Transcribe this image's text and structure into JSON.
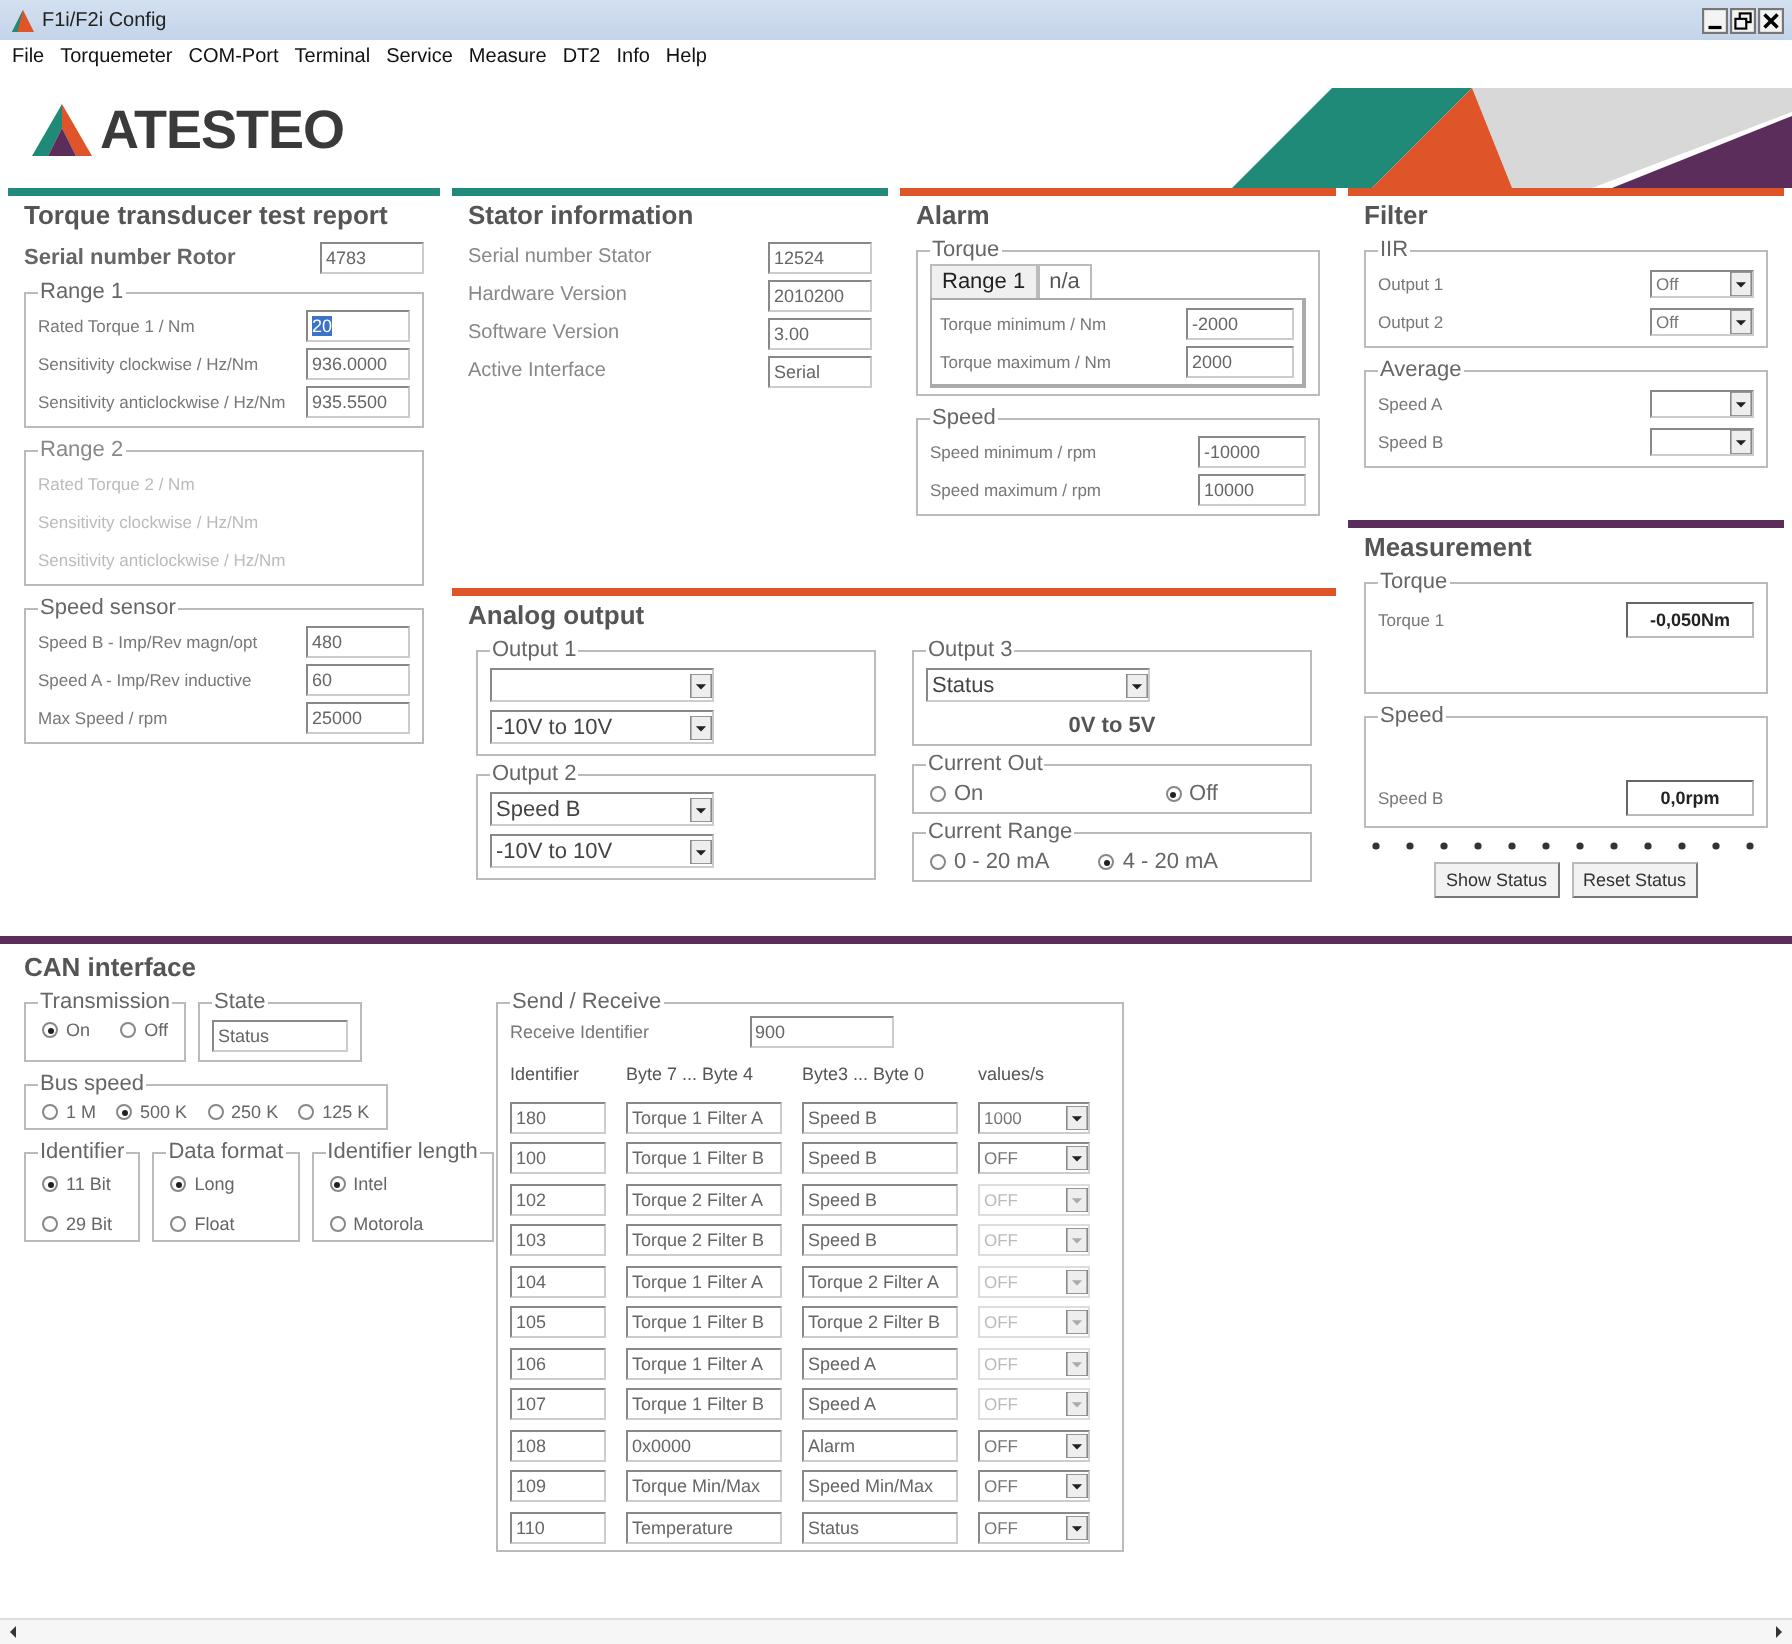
{
  "window": {
    "title": "F1i/F2i Config"
  },
  "menu": [
    "File",
    "Torquemeter",
    "COM-Port",
    "Terminal",
    "Service",
    "Measure",
    "DT2",
    "Info",
    "Help"
  ],
  "logo": {
    "text": "ATESTEO"
  },
  "test_report": {
    "title": "Torque transducer test report",
    "serial": {
      "kind": "input",
      "label": "Serial number Rotor",
      "value": "4783"
    },
    "groups": [
      {
        "title": "Range 1",
        "disabled": false,
        "items": [
          {
            "kind": "input",
            "label": "Rated Torque 1 / Nm",
            "value": "20",
            "highlighted": true
          },
          {
            "kind": "input",
            "label": "Sensitivity clockwise / Hz/Nm",
            "value": "936.0000",
            "highlighted": false
          },
          {
            "kind": "input",
            "label": "Sensitivity anticlockwise / Hz/Nm",
            "value": "935.5500",
            "highlighted": false
          }
        ]
      },
      {
        "title": "Range 2",
        "disabled": true,
        "items": [
          {
            "kind": "label",
            "label": "Rated Torque 2 / Nm"
          },
          {
            "kind": "label",
            "label": "Sensitivity clockwise / Hz/Nm"
          },
          {
            "kind": "label",
            "label": "Sensitivity anticlockwise / Hz/Nm"
          }
        ]
      },
      {
        "title": "Speed sensor",
        "disabled": false,
        "items": [
          {
            "kind": "input",
            "label": "Speed B - Imp/Rev magn/opt",
            "value": "480"
          },
          {
            "kind": "input",
            "label": "Speed A - Imp/Rev inductive",
            "value": "60"
          },
          {
            "kind": "input",
            "label": "Max Speed / rpm",
            "value": "25000"
          }
        ]
      }
    ]
  },
  "stator": {
    "title": "Stator information",
    "items": [
      {
        "kind": "input",
        "label": "Serial number Stator",
        "value": "12524"
      },
      {
        "kind": "input",
        "label": "Hardware Version",
        "value": "2010200"
      },
      {
        "kind": "input",
        "label": "Software Version",
        "value": "3.00"
      },
      {
        "kind": "input",
        "label": "Active Interface",
        "value": "Serial"
      }
    ]
  },
  "alarm": {
    "title": "Alarm",
    "torque": {
      "title": "Torque",
      "tabs": [
        {
          "label": "Range 1",
          "selected": true
        },
        {
          "label": "n/a",
          "selected": false
        }
      ],
      "items": [
        {
          "kind": "input",
          "label": "Torque minimum / Nm",
          "value": "-2000"
        },
        {
          "kind": "input",
          "label": "Torque maximum / Nm",
          "value": "2000"
        }
      ]
    },
    "speed": {
      "title": "Speed",
      "items": [
        {
          "kind": "input",
          "label": "Speed minimum / rpm",
          "value": "-10000"
        },
        {
          "kind": "input",
          "label": "Speed maximum / rpm",
          "value": "10000"
        }
      ]
    }
  },
  "filter": {
    "title": "Filter",
    "groups": [
      {
        "title": "IIR",
        "items": [
          {
            "kind": "select",
            "label": "Output 1",
            "value": "Off"
          },
          {
            "kind": "select",
            "label": "Output 2",
            "value": "Off"
          }
        ]
      },
      {
        "title": "Average",
        "items": [
          {
            "kind": "select",
            "label": "Speed A"
          },
          {
            "kind": "select",
            "label": "Speed B"
          }
        ]
      }
    ]
  },
  "analog": {
    "title": "Analog output",
    "columns": [
      [
        {
          "title": "Output 1",
          "items": [
            {
              "kind": "select"
            },
            {
              "kind": "select",
              "value": "-10V to 10V"
            }
          ]
        },
        {
          "title": "Output 2",
          "items": [
            {
              "kind": "select",
              "value": "Speed B"
            },
            {
              "kind": "select",
              "value": "-10V to 10V"
            }
          ]
        }
      ],
      [
        {
          "title": "Output 3",
          "items": [
            {
              "kind": "select",
              "value": "Status"
            },
            {
              "kind": "note",
              "text": "0V to 5V"
            }
          ]
        },
        {
          "title": "Current Out",
          "items": [
            {
              "kind": "radios",
              "options": [
                {
                  "label": "On",
                  "selected": false
                },
                {
                  "label": "Off",
                  "selected": true
                }
              ]
            }
          ]
        },
        {
          "title": "Current Range",
          "items": [
            {
              "kind": "radios",
              "options": [
                {
                  "label": "0 - 20 mA",
                  "selected": false
                },
                {
                  "label": "4 - 20 mA",
                  "selected": true
                }
              ]
            }
          ]
        }
      ]
    ]
  },
  "measurement": {
    "title": "Measurement",
    "groups": [
      {
        "title": "Torque",
        "items": [
          {
            "kind": "readout",
            "label": "Torque 1",
            "value": "-0,050Nm"
          }
        ]
      },
      {
        "title": "Speed",
        "items": [
          {
            "kind": "readout",
            "label": "Speed B",
            "value": "0,0rpm"
          }
        ]
      }
    ],
    "buttons": [
      "Show Status",
      "Reset Status"
    ]
  },
  "can": {
    "title": "CAN interface",
    "settings": [
      [
        {
          "title": "Transmission",
          "items": [
            {
              "kind": "radios",
              "options": [
                {
                  "label": "On",
                  "selected": true
                },
                {
                  "label": "Off",
                  "selected": false
                }
              ]
            }
          ]
        },
        {
          "title": "State",
          "items": [
            {
              "kind": "input",
              "value": "Status"
            }
          ]
        }
      ],
      [
        {
          "title": "Bus speed",
          "items": [
            {
              "kind": "radios",
              "options": [
                {
                  "label": "1 M",
                  "selected": false
                },
                {
                  "label": "500 K",
                  "selected": true
                },
                {
                  "label": "250 K",
                  "selected": false
                },
                {
                  "label": "125 K",
                  "selected": false
                }
              ]
            }
          ]
        }
      ],
      [
        {
          "title": "Identifier",
          "items": [
            {
              "kind": "radios-stacked",
              "options": [
                {
                  "label": "11 Bit",
                  "selected": true
                },
                {
                  "label": "29 Bit",
                  "selected": false
                }
              ]
            }
          ]
        },
        {
          "title": "Data format",
          "items": [
            {
              "kind": "radios-stacked",
              "options": [
                {
                  "label": "Long",
                  "selected": true
                },
                {
                  "label": "Float",
                  "selected": false
                }
              ]
            }
          ]
        },
        {
          "title": "Identifier length",
          "items": [
            {
              "kind": "radios-stacked",
              "options": [
                {
                  "label": "Intel",
                  "selected": true
                },
                {
                  "label": "Motorola",
                  "selected": false
                }
              ]
            }
          ]
        }
      ]
    ],
    "send_receive": {
      "title": "Send / Receive",
      "receive": {
        "label": "Receive Identifier",
        "value": "900"
      },
      "columns": [
        "Identifier",
        "Byte 7 ... Byte 4",
        "Byte3 ... Byte 0",
        "values/s"
      ],
      "rows": [
        {
          "identifier": "180",
          "byte_7_4": "Torque 1 Filter A",
          "byte_3_0": "Speed B",
          "values": "1000",
          "disabled": false
        },
        {
          "identifier": "100",
          "byte_7_4": "Torque 1 Filter B",
          "byte_3_0": "Speed B",
          "values": "OFF",
          "disabled": false
        },
        {
          "identifier": "102",
          "byte_7_4": "Torque 2 Filter A",
          "byte_3_0": "Speed B",
          "values": "OFF",
          "disabled": true
        },
        {
          "identifier": "103",
          "byte_7_4": "Torque 2 Filter B",
          "byte_3_0": "Speed B",
          "values": "OFF",
          "disabled": true
        },
        {
          "identifier": "104",
          "byte_7_4": "Torque 1 Filter A",
          "byte_3_0": "Torque 2 Filter A",
          "values": "OFF",
          "disabled": true
        },
        {
          "identifier": "105",
          "byte_7_4": "Torque 1 Filter B",
          "byte_3_0": "Torque 2 Filter B",
          "values": "OFF",
          "disabled": true
        },
        {
          "identifier": "106",
          "byte_7_4": "Torque 1 Filter A",
          "byte_3_0": "Speed A",
          "values": "OFF",
          "disabled": true
        },
        {
          "identifier": "107",
          "byte_7_4": "Torque 1 Filter B",
          "byte_3_0": "Speed A",
          "values": "OFF",
          "disabled": true
        },
        {
          "identifier": "108",
          "byte_7_4": "0x0000",
          "byte_3_0": "Alarm",
          "values": "OFF",
          "disabled": false
        },
        {
          "identifier": "109",
          "byte_7_4": "Torque Min/Max",
          "byte_3_0": "Speed Min/Max",
          "values": "OFF",
          "disabled": false
        },
        {
          "identifier": "110",
          "byte_7_4": "Temperature",
          "byte_3_0": "Status",
          "values": "OFF",
          "disabled": false
        }
      ]
    }
  }
}
